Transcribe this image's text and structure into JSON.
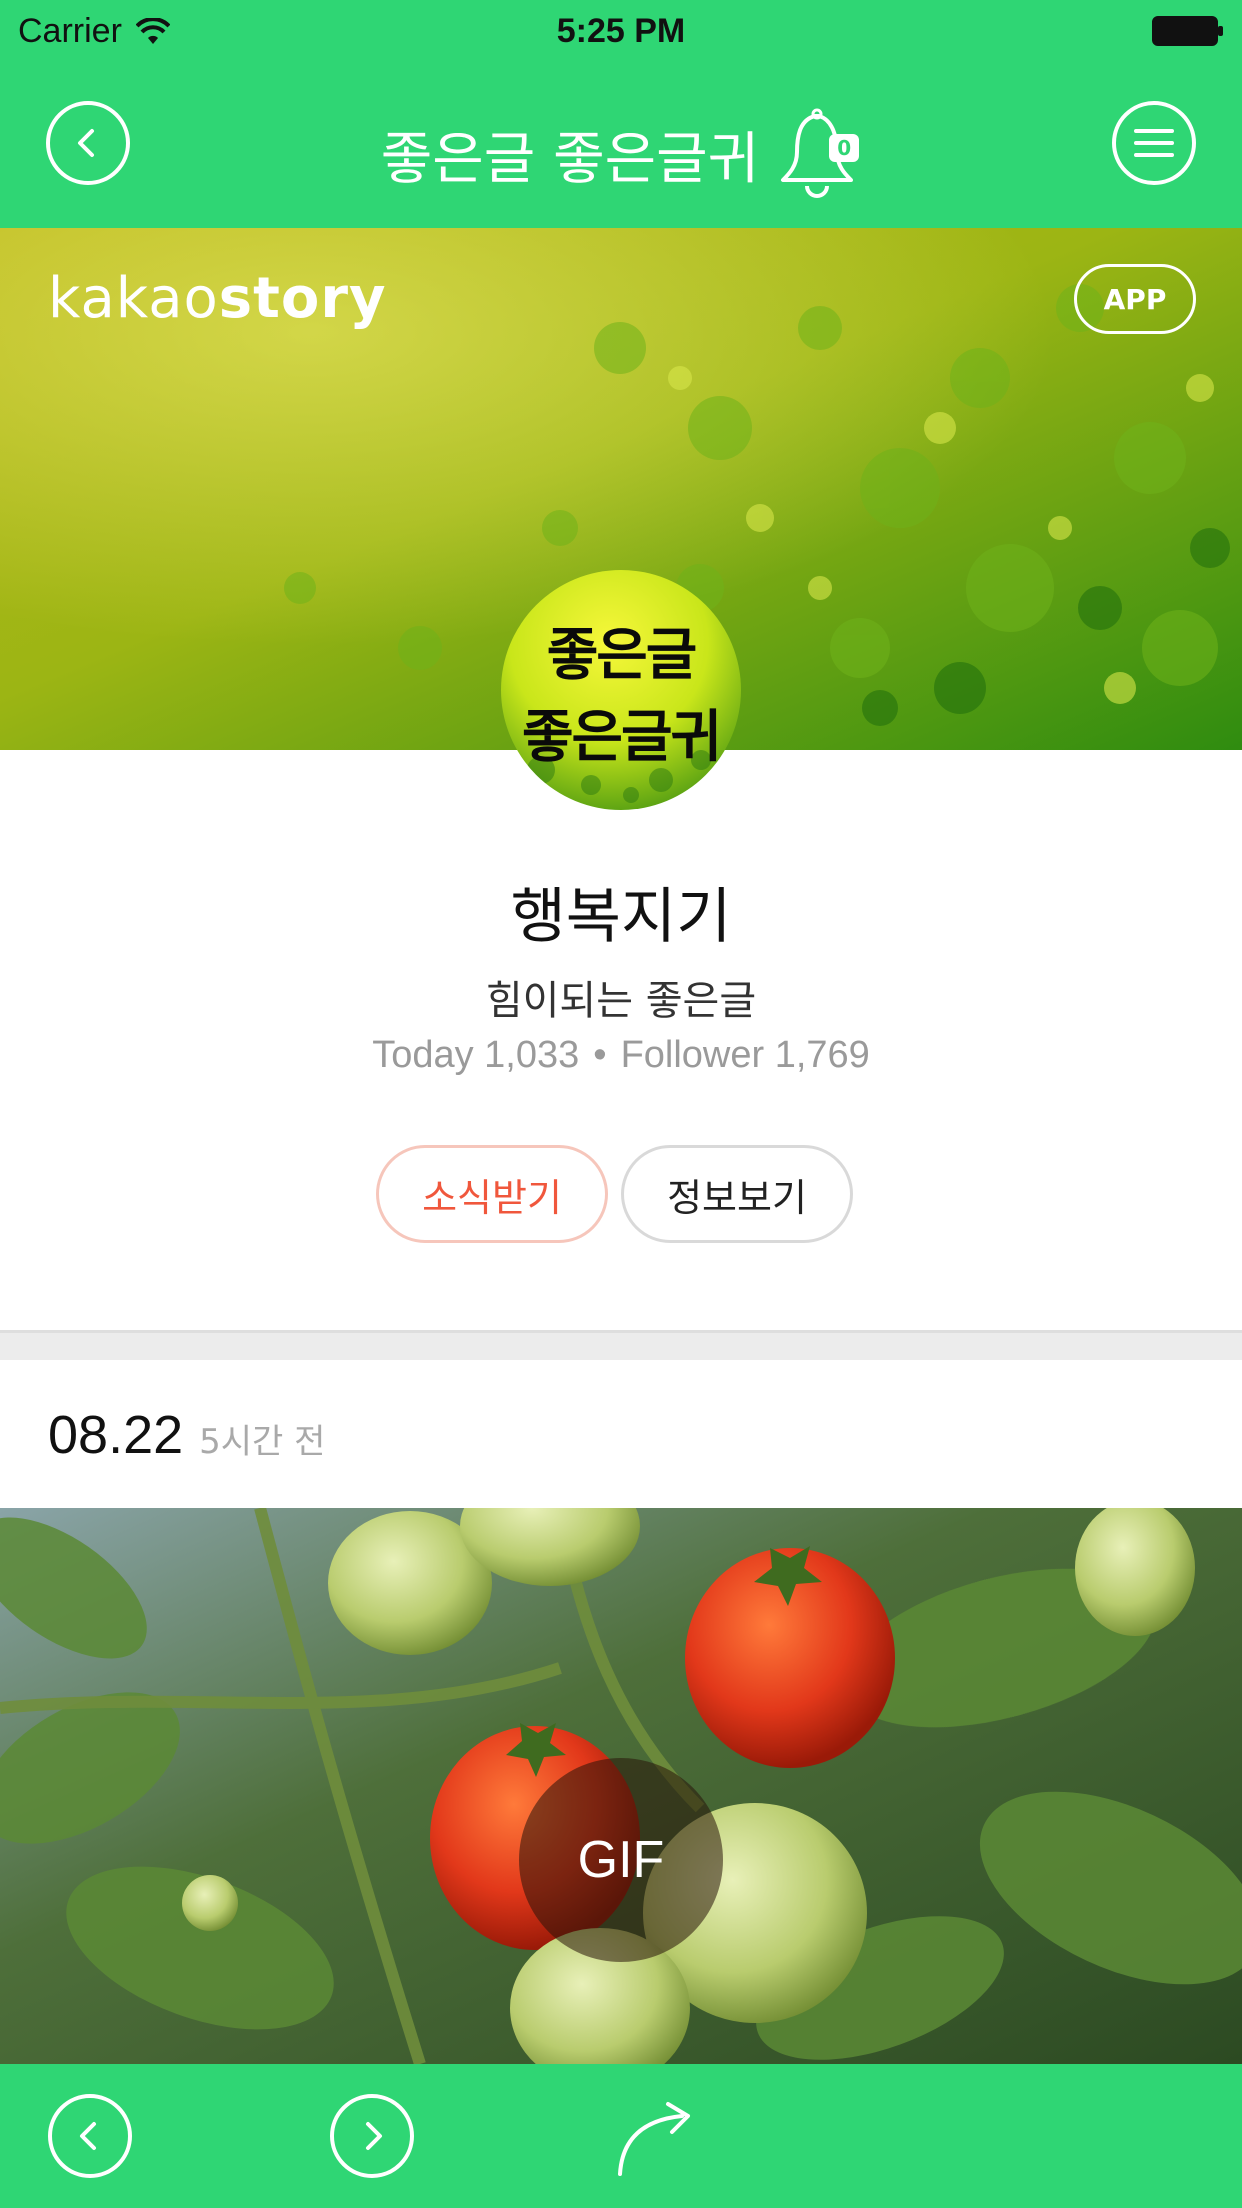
{
  "status_bar": {
    "carrier": "Carrier",
    "time": "5:25 PM"
  },
  "nav": {
    "title": "좋은글 좋은글귀",
    "notification_count": "0"
  },
  "cover": {
    "brand_light": "kakao",
    "brand_bold": "story",
    "app_label": "APP"
  },
  "avatar": {
    "line1": "좋은글",
    "line2": "좋은글귀"
  },
  "profile": {
    "name": "행복지기",
    "tagline": "힘이되는 좋은글",
    "today": "Today 1,033",
    "separator": "•",
    "followers": "Follower 1,769",
    "subscribe_label": "소식받기",
    "info_label": "정보보기"
  },
  "post": {
    "date": "08.22",
    "ago": "5시간 전",
    "media_badge": "GIF"
  },
  "colors": {
    "brand_green": "#2fd674",
    "subscribe_red": "#f0573c"
  },
  "icons": [
    "back-icon",
    "menu-icon",
    "bell-icon",
    "wifi-icon",
    "battery-icon",
    "prev-icon",
    "next-icon",
    "share-icon"
  ]
}
